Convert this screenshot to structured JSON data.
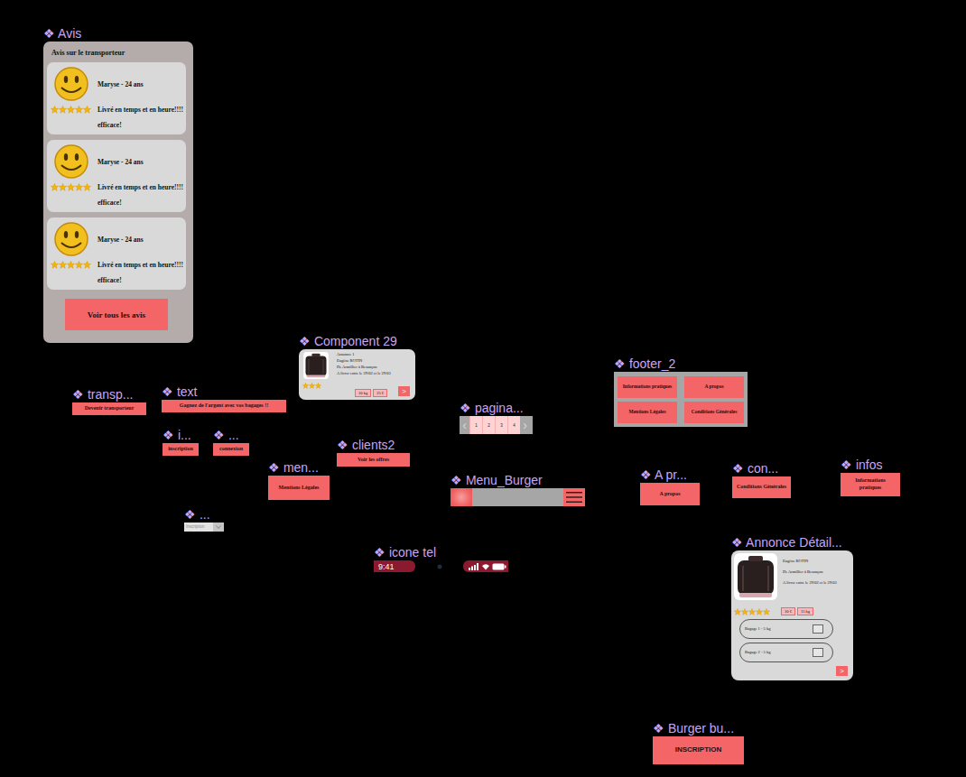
{
  "nodes": [
    {
      "label": "❖ Avis",
      "kind": "avis",
      "title": "Avis sur le transporteur",
      "reviews": [
        {
          "name": "Maryse - 24 ans",
          "stars": 5,
          "text": "Livré en temps et en heure!!!! efficace!"
        },
        {
          "name": "Maryse - 24 ans",
          "stars": 5,
          "text": "Livré en temps et en heure!!!! efficace!"
        },
        {
          "name": "Maryse - 24 ans",
          "stars": 5,
          "text": "Livré en temps et en heure!!!! efficace!"
        }
      ],
      "button": "Voir tous les avis"
    },
    {
      "label": "❖ Component 29",
      "kind": "annonce",
      "lines": [
        "Annonce 1",
        "Eugène ROTIN",
        "De Armillier à Besançon",
        "A livrer entre le 29/02 et le 29/03"
      ],
      "stars": 3,
      "tags": [
        "10 kg",
        "25 €"
      ],
      "arrow": ">"
    },
    {
      "label": "❖ transp...",
      "kind": "button",
      "text": "Devenir transporteur"
    },
    {
      "label": "❖ text",
      "kind": "button",
      "text": "Gagnez de l'argent avec vos bagages !!"
    },
    {
      "label": "❖ i...",
      "kind": "button",
      "text": "inscription"
    },
    {
      "label": "❖ ...",
      "kind": "button",
      "text": "connexion"
    },
    {
      "label": "❖ men...",
      "kind": "button",
      "text": "Mentions Légales"
    },
    {
      "label": "❖ clients2",
      "kind": "button",
      "text": "Voir les offres"
    },
    {
      "label": "❖ ...",
      "kind": "dropdown",
      "text": "Inscription",
      "expanded": false
    },
    {
      "label": "❖ pagina...",
      "kind": "pagination",
      "prev": "‹",
      "next": "›",
      "pages": [
        {
          "text": "1",
          "selected": false
        },
        {
          "text": "2",
          "selected": false
        },
        {
          "text": "3",
          "selected": false
        },
        {
          "text": "4",
          "selected": false
        }
      ]
    },
    {
      "label": "❖ Menu_Burger",
      "kind": "menu"
    },
    {
      "label": "❖ icone tel",
      "kind": "statusbar",
      "time": "9:41"
    },
    {
      "label": "❖ footer_2",
      "kind": "footer",
      "links": [
        "Informations pratiques",
        "A propos",
        "Mentions Légales",
        "Conditions Générales"
      ]
    },
    {
      "label": "❖ A pr...",
      "kind": "button",
      "text": "A propos"
    },
    {
      "label": "❖ con...",
      "kind": "button",
      "text": "Conditions Générales"
    },
    {
      "label": "❖ infos",
      "kind": "button",
      "text": "Informations pratiques"
    },
    {
      "label": "❖ Annonce Détail...",
      "kind": "detail",
      "lines": [
        "Eugène ROTIN",
        "De Armillier à Besançon",
        "A livrer entre le 29/02 et le 29/03"
      ],
      "stars": 5,
      "tags": [
        "10 €",
        "15 kg"
      ],
      "bagages": [
        {
          "text": "Bagage 1 - 5 kg",
          "checked": false
        },
        {
          "text": "Bagage 2 - 5 kg",
          "checked": false
        }
      ],
      "arrow": ">"
    },
    {
      "label": "❖ Burger bu...",
      "kind": "button",
      "text": "INSCRIPTION"
    }
  ]
}
